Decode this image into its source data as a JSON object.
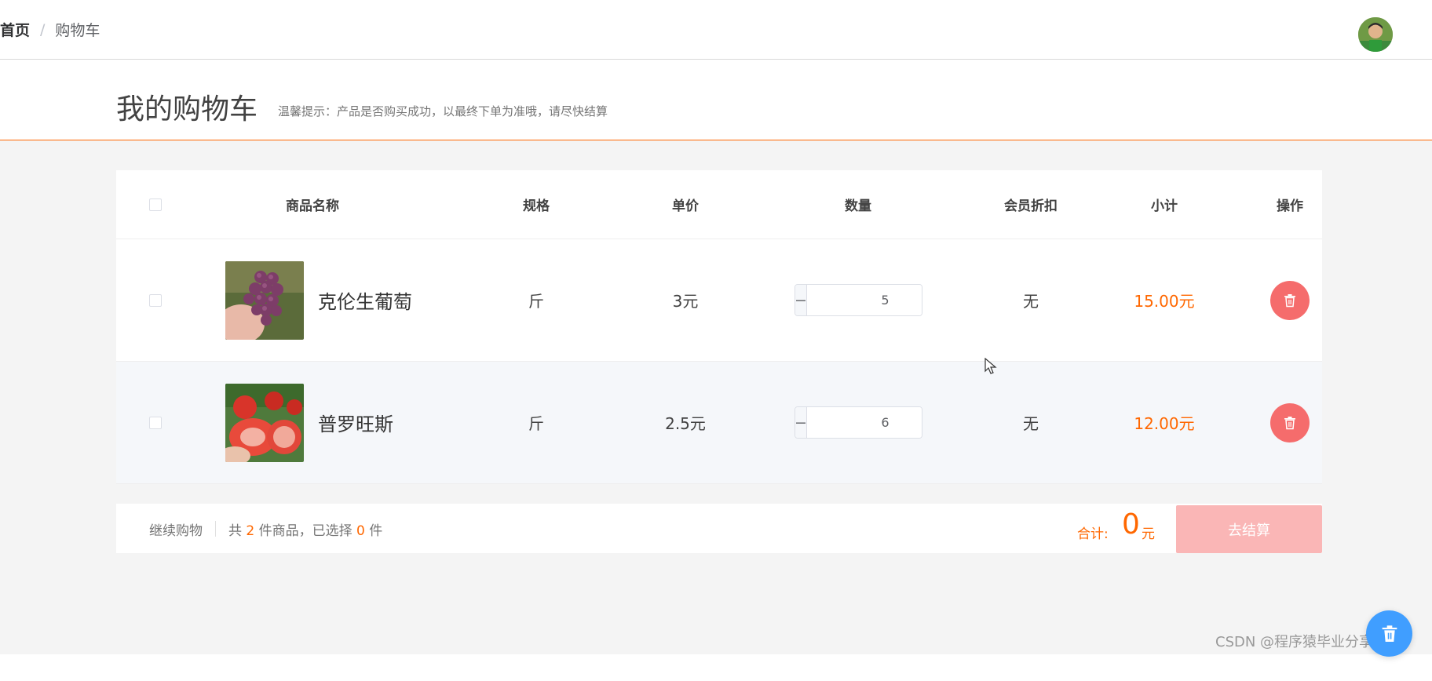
{
  "breadcrumb": {
    "home": "首页",
    "separator": "/",
    "current": "购物车"
  },
  "header": {
    "title": "我的购物车",
    "tip": "温馨提示：产品是否购买成功，以最终下单为准哦，请尽快结算"
  },
  "table": {
    "columns": {
      "name": "商品名称",
      "spec": "规格",
      "price": "单价",
      "qty": "数量",
      "discount": "会员折扣",
      "subtotal": "小计",
      "operation": "操作"
    },
    "rows": [
      {
        "name": "克伦生葡萄",
        "spec": "斤",
        "price": "3元",
        "qty": "5",
        "discount": "无",
        "subtotal": "15.00元",
        "image": "grapes-image",
        "checked": false
      },
      {
        "name": "普罗旺斯",
        "spec": "斤",
        "price": "2.5元",
        "qty": "6",
        "discount": "无",
        "subtotal": "12.00元",
        "image": "tomato-image",
        "checked": false
      }
    ]
  },
  "footer": {
    "continue": "继续购物",
    "count_prefix": "共",
    "count_total": "2",
    "count_middle": "件商品，已选择",
    "count_selected": "0",
    "count_suffix": "件",
    "total_label": "合计:",
    "total_value": "0",
    "total_unit": "元",
    "checkout": "去结算"
  },
  "watermark": "CSDN @程序猿毕业分享网",
  "icons": {
    "delete": "trash-icon",
    "fab": "trash-icon",
    "minus": "minus-icon",
    "plus": "plus-icon"
  },
  "colors": {
    "accent": "#ff6700",
    "danger": "#f56c6c",
    "primary": "#409eff",
    "checkout_disabled": "#fab6b6"
  }
}
